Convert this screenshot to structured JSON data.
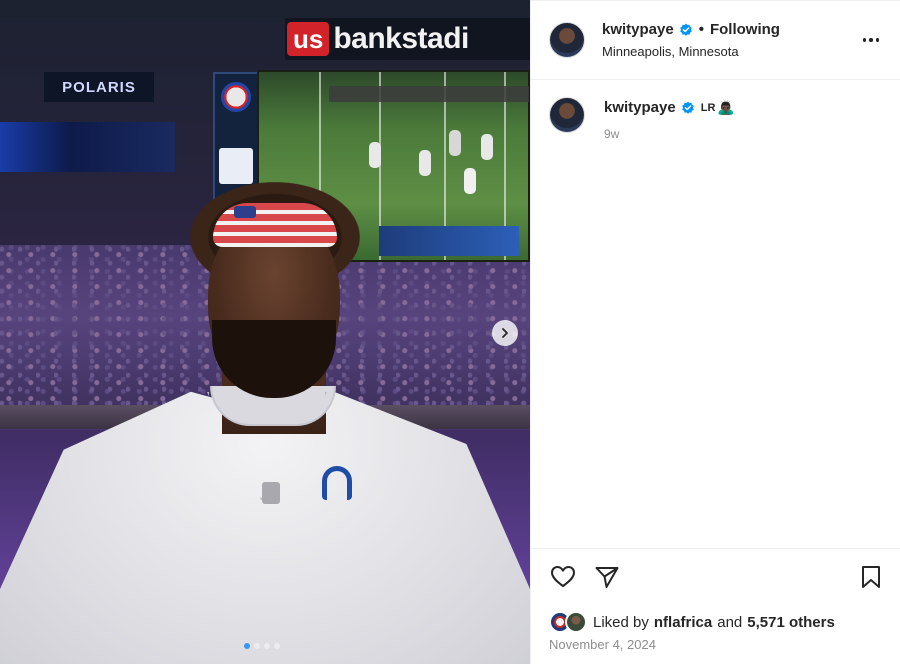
{
  "media": {
    "stadium_sign": {
      "brand": "us",
      "text": "bankstadi"
    },
    "polaris_sign": "POLARIS",
    "carousel": {
      "total": 4,
      "current": 1
    }
  },
  "header": {
    "username": "kwitypaye",
    "separator": "•",
    "follow_status": "Following",
    "location": "Minneapolis, Minnesota"
  },
  "caption": {
    "username": "kwitypaye",
    "text": "LR",
    "emoji": "🙇🏿‍♂️",
    "time_ago": "9w"
  },
  "likes": {
    "prefix": "Liked by",
    "liker": "nflafrica",
    "and": "and",
    "others": "5,571 others"
  },
  "post_date": "November 4, 2024",
  "colors": {
    "verified": "#0095f6",
    "primary_text": "#262626",
    "secondary_text": "#8e8e8e",
    "divider": "#efefef"
  },
  "icons": {
    "like": "heart-icon",
    "share": "paper-plane-icon",
    "save": "bookmark-icon",
    "more": "more-horizontal-icon",
    "verified": "verified-badge-icon",
    "next": "chevron-right-icon"
  }
}
